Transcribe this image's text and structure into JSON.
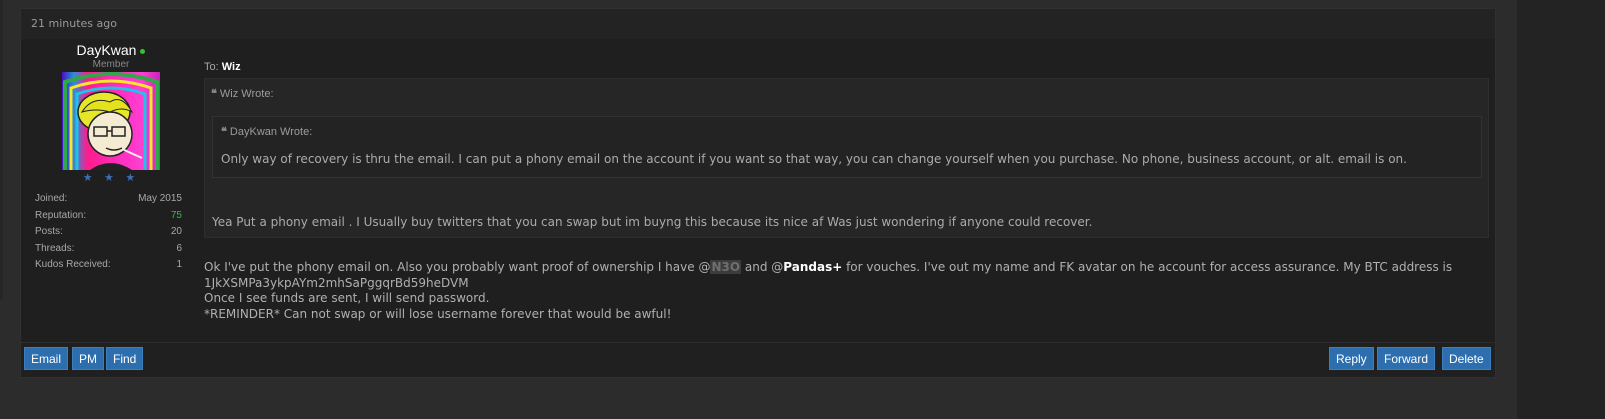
{
  "post": {
    "timestamp": "21 minutes ago",
    "author": {
      "name": "DayKwan",
      "rank": "Member",
      "stars": "★ ★ ★",
      "stats": [
        {
          "label": "Joined:",
          "value": "May 2015"
        },
        {
          "label": "Reputation:",
          "value": "75"
        },
        {
          "label": "Posts:",
          "value": "20"
        },
        {
          "label": "Threads:",
          "value": "6"
        },
        {
          "label": "Kudos Received:",
          "value": "1"
        }
      ]
    },
    "to_label": "To:",
    "to_name": "Wiz",
    "quote_icon": "❝",
    "quote_outer": {
      "title": "Wiz Wrote:",
      "text": "Yea Put a phony email .  I Usually buy twitters that you can swap but im buyng this because its nice af Was just wondering if anyone could recover."
    },
    "quote_inner": {
      "title": "DayKwan Wrote:",
      "text": "Only way of recovery is thru the email. I can put a phony email on the account if you want so that way, you can change yourself when you purchase. No phone, business account, or alt. email is on."
    },
    "message": {
      "part1": "Ok I've put the phony email on. Also you probably want proof of ownership I have @",
      "mention1": "N3O",
      "part2": " and @",
      "mention2": "Pandas+",
      "part3": " for vouches. I've out my name and FK avatar on he account for access assurance. My BTC address is",
      "line2": "1JkXSMPa3ykpAYm2mhSaPggqrBd59heDVM",
      "line3": "Once I see funds are sent, I will send password.",
      "line4": "*REMINDER* Can not swap or will lose username forever that would be awful!"
    }
  },
  "buttons": {
    "email": "Email",
    "pm": "PM",
    "find": "Find",
    "reply": "Reply",
    "forward": "Forward",
    "delete": "Delete"
  },
  "colors": {
    "accent": "#2d6fae",
    "online": "#2ec52e",
    "reputation": "#2fbf3f"
  }
}
